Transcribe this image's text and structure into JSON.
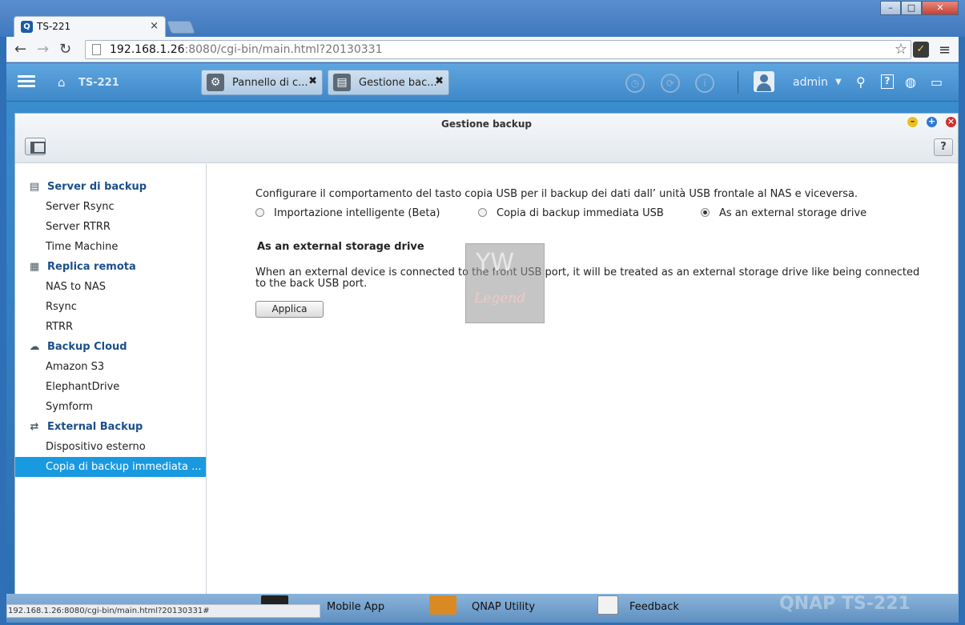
{
  "browser": {
    "tab_title": "TS-221",
    "tab_close": "×",
    "favicon_letter": "Q",
    "url_host": "192.168.1.26",
    "url_rest": ":8080/cgi-bin/main.html?20130331",
    "status_text": "192.168.1.26:8080/cgi-bin/main.html?20130331#"
  },
  "qnap": {
    "home_title": "TS-221",
    "tabs": [
      {
        "label": "Pannello di c...",
        "close": "✖"
      },
      {
        "label": "Gestione bac...",
        "close": "✖"
      }
    ],
    "user": "admin"
  },
  "window": {
    "title": "Gestione backup",
    "help_label": "?",
    "sidebar": {
      "groups": [
        {
          "label": "Server di backup",
          "items": [
            "Server Rsync",
            "Server RTRR",
            "Time Machine"
          ]
        },
        {
          "label": "Replica remota",
          "items": [
            "NAS to NAS",
            "Rsync",
            "RTRR"
          ]
        },
        {
          "label": "Backup Cloud",
          "items": [
            "Amazon S3",
            "ElephantDrive",
            "Symform"
          ]
        },
        {
          "label": "External Backup",
          "items": [
            "Dispositivo esterno",
            "Copia di backup immediata ..."
          ]
        }
      ],
      "selected": "Copia di backup immediata ..."
    },
    "main": {
      "description": "Configurare il comportamento del tasto copia USB per il backup dei dati dall’ unità USB frontale al NAS e viceversa.",
      "options": [
        "Importazione intelligente (Beta)",
        "Copia di backup immediata USB",
        "As an external storage drive"
      ],
      "selected_option": "As an external storage drive",
      "section_title": "As an external storage drive",
      "section_text": "When an external device is connected to the front USB port, it will be treated as an external storage drive like being connected to the back USB port.",
      "apply_label": "Applica"
    }
  },
  "dock": {
    "items": [
      "Mobile App",
      "QNAP Utility",
      "Feedback"
    ],
    "brand": "QNAP   TS-221"
  },
  "watermark": {
    "text": "Legend"
  }
}
